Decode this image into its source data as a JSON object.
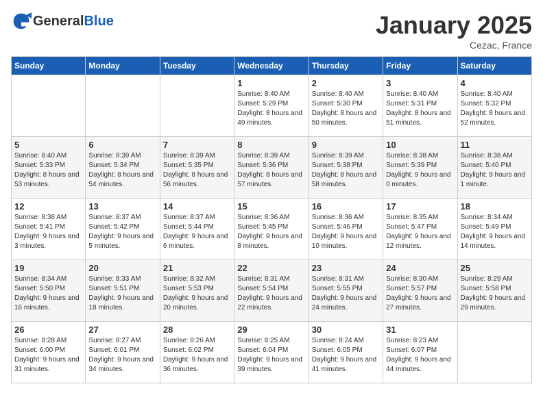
{
  "header": {
    "logo_general": "General",
    "logo_blue": "Blue",
    "month_title": "January 2025",
    "location": "Cezac, France"
  },
  "days_of_week": [
    "Sunday",
    "Monday",
    "Tuesday",
    "Wednesday",
    "Thursday",
    "Friday",
    "Saturday"
  ],
  "weeks": [
    [
      {
        "day": "",
        "sunrise": "",
        "sunset": "",
        "daylight": ""
      },
      {
        "day": "",
        "sunrise": "",
        "sunset": "",
        "daylight": ""
      },
      {
        "day": "",
        "sunrise": "",
        "sunset": "",
        "daylight": ""
      },
      {
        "day": "1",
        "sunrise": "Sunrise: 8:40 AM",
        "sunset": "Sunset: 5:29 PM",
        "daylight": "Daylight: 8 hours and 49 minutes."
      },
      {
        "day": "2",
        "sunrise": "Sunrise: 8:40 AM",
        "sunset": "Sunset: 5:30 PM",
        "daylight": "Daylight: 8 hours and 50 minutes."
      },
      {
        "day": "3",
        "sunrise": "Sunrise: 8:40 AM",
        "sunset": "Sunset: 5:31 PM",
        "daylight": "Daylight: 8 hours and 51 minutes."
      },
      {
        "day": "4",
        "sunrise": "Sunrise: 8:40 AM",
        "sunset": "Sunset: 5:32 PM",
        "daylight": "Daylight: 8 hours and 52 minutes."
      }
    ],
    [
      {
        "day": "5",
        "sunrise": "Sunrise: 8:40 AM",
        "sunset": "Sunset: 5:33 PM",
        "daylight": "Daylight: 8 hours and 53 minutes."
      },
      {
        "day": "6",
        "sunrise": "Sunrise: 8:39 AM",
        "sunset": "Sunset: 5:34 PM",
        "daylight": "Daylight: 8 hours and 54 minutes."
      },
      {
        "day": "7",
        "sunrise": "Sunrise: 8:39 AM",
        "sunset": "Sunset: 5:35 PM",
        "daylight": "Daylight: 8 hours and 56 minutes."
      },
      {
        "day": "8",
        "sunrise": "Sunrise: 8:39 AM",
        "sunset": "Sunset: 5:36 PM",
        "daylight": "Daylight: 8 hours and 57 minutes."
      },
      {
        "day": "9",
        "sunrise": "Sunrise: 8:39 AM",
        "sunset": "Sunset: 5:38 PM",
        "daylight": "Daylight: 8 hours and 58 minutes."
      },
      {
        "day": "10",
        "sunrise": "Sunrise: 8:38 AM",
        "sunset": "Sunset: 5:39 PM",
        "daylight": "Daylight: 9 hours and 0 minutes."
      },
      {
        "day": "11",
        "sunrise": "Sunrise: 8:38 AM",
        "sunset": "Sunset: 5:40 PM",
        "daylight": "Daylight: 9 hours and 1 minute."
      }
    ],
    [
      {
        "day": "12",
        "sunrise": "Sunrise: 8:38 AM",
        "sunset": "Sunset: 5:41 PM",
        "daylight": "Daylight: 9 hours and 3 minutes."
      },
      {
        "day": "13",
        "sunrise": "Sunrise: 8:37 AM",
        "sunset": "Sunset: 5:42 PM",
        "daylight": "Daylight: 9 hours and 5 minutes."
      },
      {
        "day": "14",
        "sunrise": "Sunrise: 8:37 AM",
        "sunset": "Sunset: 5:44 PM",
        "daylight": "Daylight: 9 hours and 6 minutes."
      },
      {
        "day": "15",
        "sunrise": "Sunrise: 8:36 AM",
        "sunset": "Sunset: 5:45 PM",
        "daylight": "Daylight: 9 hours and 8 minutes."
      },
      {
        "day": "16",
        "sunrise": "Sunrise: 8:36 AM",
        "sunset": "Sunset: 5:46 PM",
        "daylight": "Daylight: 9 hours and 10 minutes."
      },
      {
        "day": "17",
        "sunrise": "Sunrise: 8:35 AM",
        "sunset": "Sunset: 5:47 PM",
        "daylight": "Daylight: 9 hours and 12 minutes."
      },
      {
        "day": "18",
        "sunrise": "Sunrise: 8:34 AM",
        "sunset": "Sunset: 5:49 PM",
        "daylight": "Daylight: 9 hours and 14 minutes."
      }
    ],
    [
      {
        "day": "19",
        "sunrise": "Sunrise: 8:34 AM",
        "sunset": "Sunset: 5:50 PM",
        "daylight": "Daylight: 9 hours and 16 minutes."
      },
      {
        "day": "20",
        "sunrise": "Sunrise: 8:33 AM",
        "sunset": "Sunset: 5:51 PM",
        "daylight": "Daylight: 9 hours and 18 minutes."
      },
      {
        "day": "21",
        "sunrise": "Sunrise: 8:32 AM",
        "sunset": "Sunset: 5:53 PM",
        "daylight": "Daylight: 9 hours and 20 minutes."
      },
      {
        "day": "22",
        "sunrise": "Sunrise: 8:31 AM",
        "sunset": "Sunset: 5:54 PM",
        "daylight": "Daylight: 9 hours and 22 minutes."
      },
      {
        "day": "23",
        "sunrise": "Sunrise: 8:31 AM",
        "sunset": "Sunset: 5:55 PM",
        "daylight": "Daylight: 9 hours and 24 minutes."
      },
      {
        "day": "24",
        "sunrise": "Sunrise: 8:30 AM",
        "sunset": "Sunset: 5:57 PM",
        "daylight": "Daylight: 9 hours and 27 minutes."
      },
      {
        "day": "25",
        "sunrise": "Sunrise: 8:29 AM",
        "sunset": "Sunset: 5:58 PM",
        "daylight": "Daylight: 9 hours and 29 minutes."
      }
    ],
    [
      {
        "day": "26",
        "sunrise": "Sunrise: 8:28 AM",
        "sunset": "Sunset: 6:00 PM",
        "daylight": "Daylight: 9 hours and 31 minutes."
      },
      {
        "day": "27",
        "sunrise": "Sunrise: 8:27 AM",
        "sunset": "Sunset: 6:01 PM",
        "daylight": "Daylight: 9 hours and 34 minutes."
      },
      {
        "day": "28",
        "sunrise": "Sunrise: 8:26 AM",
        "sunset": "Sunset: 6:02 PM",
        "daylight": "Daylight: 9 hours and 36 minutes."
      },
      {
        "day": "29",
        "sunrise": "Sunrise: 8:25 AM",
        "sunset": "Sunset: 6:04 PM",
        "daylight": "Daylight: 9 hours and 39 minutes."
      },
      {
        "day": "30",
        "sunrise": "Sunrise: 8:24 AM",
        "sunset": "Sunset: 6:05 PM",
        "daylight": "Daylight: 9 hours and 41 minutes."
      },
      {
        "day": "31",
        "sunrise": "Sunrise: 8:23 AM",
        "sunset": "Sunset: 6:07 PM",
        "daylight": "Daylight: 9 hours and 44 minutes."
      },
      {
        "day": "",
        "sunrise": "",
        "sunset": "",
        "daylight": ""
      }
    ]
  ]
}
